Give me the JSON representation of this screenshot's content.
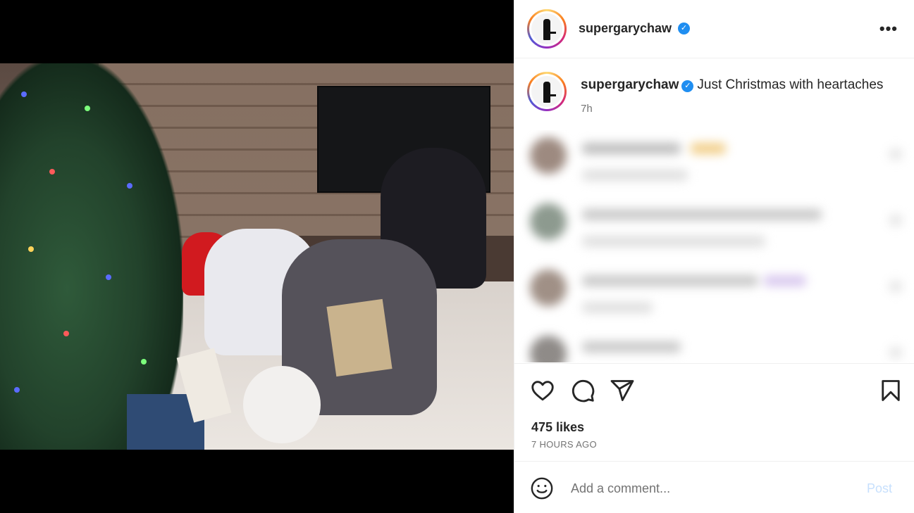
{
  "post": {
    "username": "supergarychaw",
    "verified": true,
    "more_icon": "more-horizontal-icon"
  },
  "caption": {
    "username": "supergarychaw",
    "text": "Just Christmas with heartaches",
    "time": "7h"
  },
  "actions": {
    "like_icon": "heart-icon",
    "comment_icon": "comment-icon",
    "share_icon": "send-icon",
    "save_icon": "bookmark-icon",
    "likes": "475 likes",
    "posted": "7 HOURS AGO"
  },
  "composer": {
    "emoji_icon": "emoji-icon",
    "placeholder": "Add a comment...",
    "post_label": "Post"
  },
  "colors": {
    "verified": "#1f8ef1",
    "post_disabled": "#c7e0fd",
    "secondary_text": "#737373"
  }
}
